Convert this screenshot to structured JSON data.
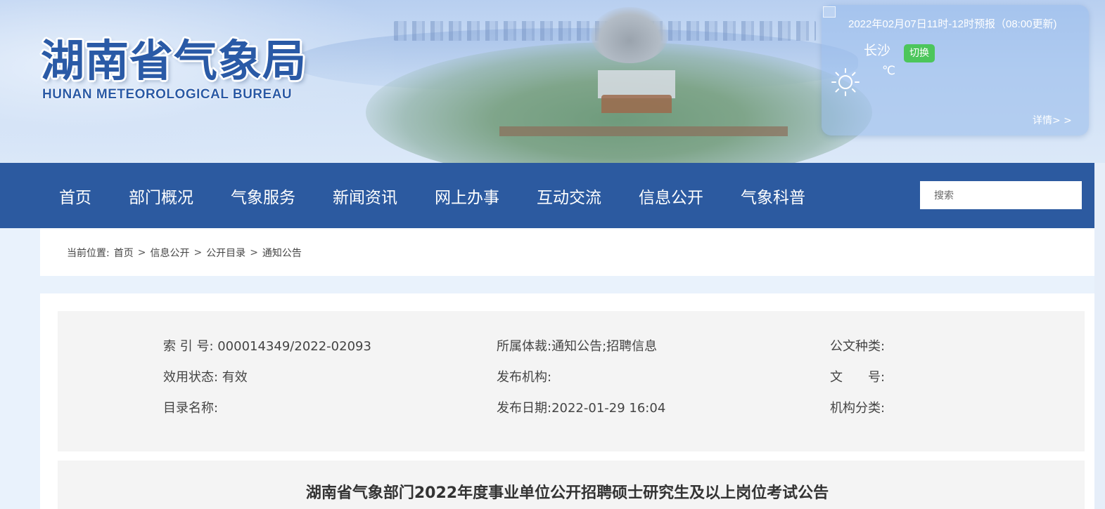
{
  "header": {
    "logo_cn": "湖南省气象局",
    "logo_en": "HUNAN METEOROLOGICAL BUREAU"
  },
  "weather": {
    "forecast_time": "2022年02月07日11时-12时预报（08:00更新)",
    "city": "长沙",
    "switch_label": "切换",
    "icon": "sun-icon",
    "temperature_unit": "℃",
    "details_link": "详情> >"
  },
  "nav": {
    "items": [
      "首页",
      "部门概况",
      "气象服务",
      "新闻资讯",
      "网上办事",
      "互动交流",
      "信息公开",
      "气象科普"
    ],
    "search_placeholder": "搜索"
  },
  "breadcrumb": {
    "prefix": "当前位置:",
    "items": [
      "首页",
      "信息公开",
      "公开目录",
      "通知公告"
    ],
    "separator": ">"
  },
  "meta": {
    "index_no": "索 引 号: 000014349/2022-02093",
    "category": "所属体裁:通知公告;招聘信息",
    "doc_type": "公文种类:",
    "status": "效用状态: 有效",
    "publisher": "发布机构:",
    "doc_no": "文　　号:",
    "catalog": "目录名称:",
    "publish_date": "发布日期:2022-01-29 16:04",
    "org_type": "机构分类:"
  },
  "article": {
    "title": "湖南省气象部门2022年度事业单位公开招聘硕士研究生及以上岗位考试公告"
  },
  "colors": {
    "nav_bg": "#2c5aa0",
    "logo_blue": "#2a5aa6",
    "switch_green": "#4cc65b",
    "page_bg": "#e9f2fc"
  }
}
